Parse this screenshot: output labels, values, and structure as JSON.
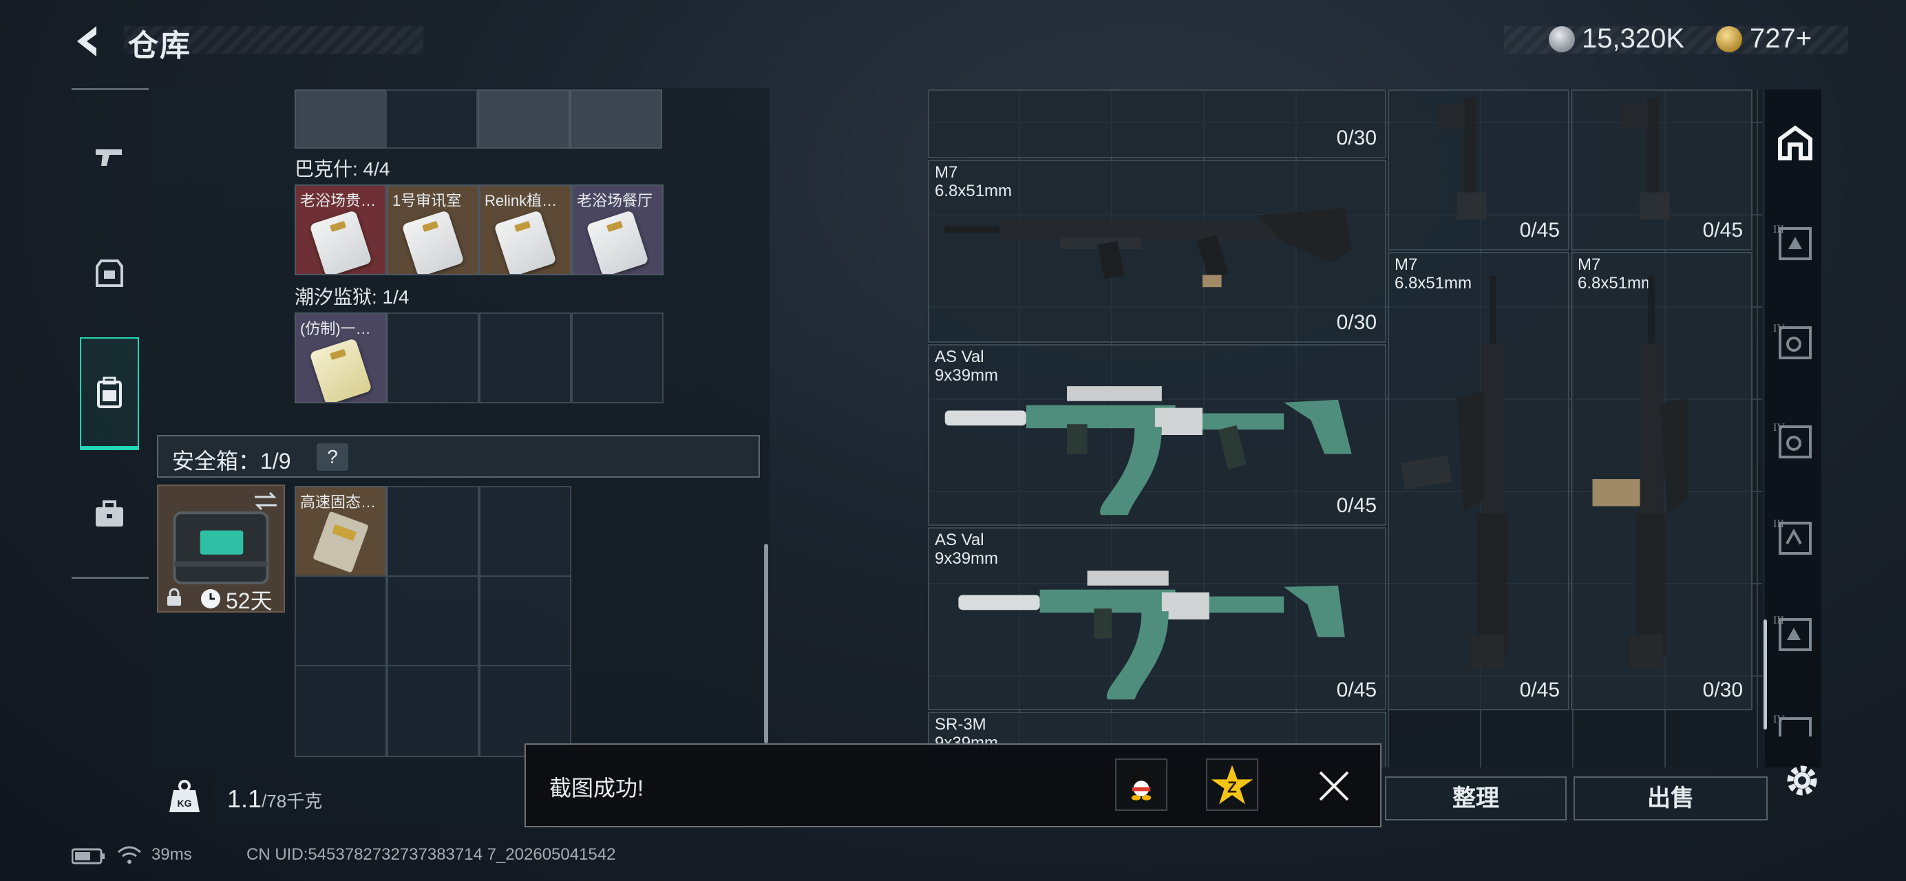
{
  "header": {
    "title": "仓库",
    "currency1": "15,320K",
    "currency2": "727+"
  },
  "left_nav": {
    "items": [
      {
        "name": "weapons",
        "icon": "pistol-icon"
      },
      {
        "name": "equipment",
        "icon": "armor-icon"
      },
      {
        "name": "backpack",
        "icon": "backpack-icon"
      },
      {
        "name": "supplies",
        "icon": "briefcase-icon"
      }
    ],
    "active": "backpack"
  },
  "keycard_groups": [
    {
      "label": "巴克什: 4/4",
      "cards": [
        "老浴场贵…",
        "1号审讯室",
        "Relink植…",
        "老浴场餐厅"
      ]
    },
    {
      "label": "潮汐监狱: 1/4",
      "cards": [
        "(仿制)一…"
      ]
    }
  ],
  "safebox": {
    "label": "安全箱：1/9",
    "help": "?",
    "days": "52天",
    "item_label": "高速固态…"
  },
  "weight": {
    "current": "1.1",
    "max": "/78千克"
  },
  "warehouse": {
    "top_row": [
      {
        "ammo": "0/30"
      },
      {
        "ammo": "0/45"
      },
      {
        "ammo": "0/45"
      }
    ],
    "items": [
      {
        "name": "M7",
        "caliber": "6.8x51mm",
        "ammo": "0/30"
      },
      {
        "name": "M7",
        "caliber": "6.8x51mm",
        "ammo": "0/45"
      },
      {
        "name": "M7",
        "caliber": "6.8x51mm",
        "ammo": "0/30"
      },
      {
        "name": "AS Val",
        "caliber": "9x39mm",
        "ammo": "0/45"
      },
      {
        "name": "AS Val",
        "caliber": "9x39mm",
        "ammo": "0/45"
      },
      {
        "name": "SR-3M",
        "caliber": "9x39mm",
        "ammo": ""
      }
    ],
    "tiers": [
      "III",
      "IV",
      "IV",
      "III",
      "III",
      "IV"
    ]
  },
  "actions": {
    "sort": "整理",
    "sell": "出售"
  },
  "toast": {
    "text": "截图成功!"
  },
  "status": {
    "ping": "39ms",
    "uid": "CN UID:5453782732737383714 7_202605041542"
  },
  "colors": {
    "accent": "#21d6b4",
    "rare_purple": "#4a4660",
    "epic_red": "#6e3034",
    "gold_brown": "#5c4a36"
  }
}
